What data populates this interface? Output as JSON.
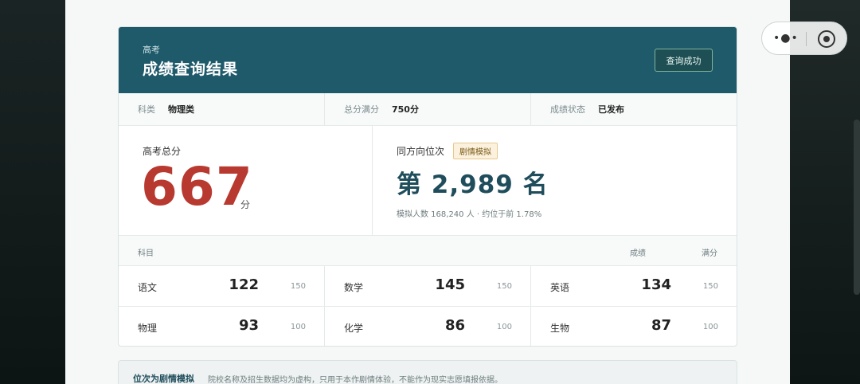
{
  "header": {
    "eyebrow": "高考",
    "title": "成绩查询结果",
    "status_button": "查询成功"
  },
  "meta": [
    {
      "key": "科类",
      "value": "物理类"
    },
    {
      "key": "总分满分",
      "value": "750分"
    },
    {
      "key": "成绩状态",
      "value": "已发布"
    }
  ],
  "total": {
    "label": "高考总分",
    "score": "667",
    "unit": "分"
  },
  "rank": {
    "label": "同方向位次",
    "badge": "剧情模拟",
    "value": "第 2,989 名",
    "note": "模拟人数 168,240 人 · 约位于前 1.78%"
  },
  "subjects_header": {
    "subject": "科目",
    "score": "成绩",
    "max": "满分"
  },
  "subjects": [
    {
      "name": "语文",
      "score": "122",
      "max": "150"
    },
    {
      "name": "数学",
      "score": "145",
      "max": "150"
    },
    {
      "name": "英语",
      "score": "134",
      "max": "150"
    },
    {
      "name": "物理",
      "score": "93",
      "max": "100"
    },
    {
      "name": "化学",
      "score": "86",
      "max": "100"
    },
    {
      "name": "生物",
      "score": "87",
      "max": "100"
    }
  ],
  "notice": {
    "title": "位次为剧情模拟",
    "text": "院校名称及招生数据均为虚构，只用于本作剧情体验，不能作为现实志愿填报依据。"
  }
}
